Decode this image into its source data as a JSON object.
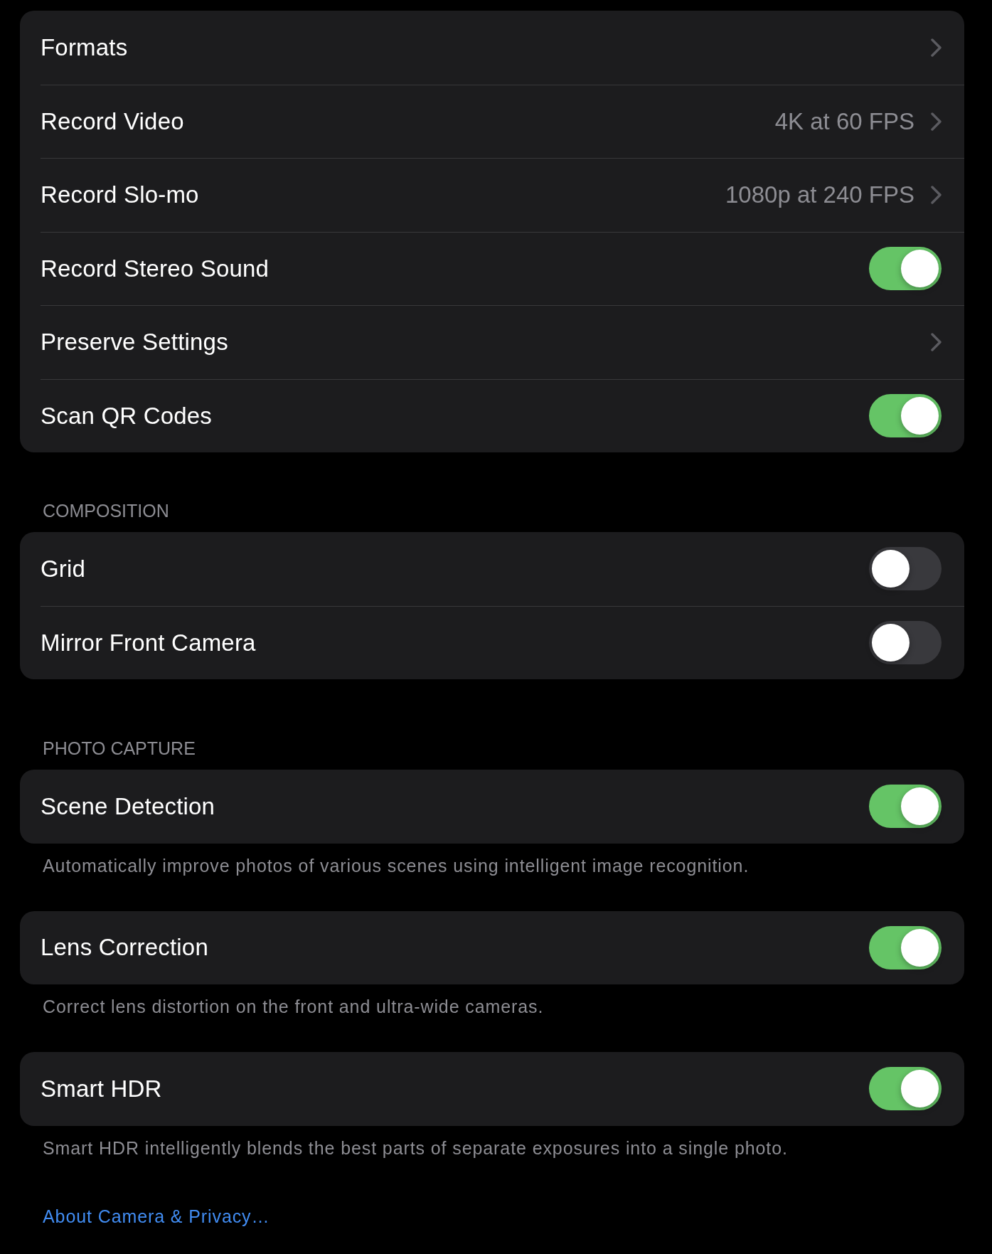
{
  "sections": [
    {
      "rows": [
        {
          "kind": "link",
          "label": "Formats"
        },
        {
          "kind": "link",
          "label": "Record Video",
          "value": "4K at 60 FPS"
        },
        {
          "kind": "link",
          "label": "Record Slo-mo",
          "value": "1080p at 240 FPS"
        },
        {
          "kind": "toggle",
          "label": "Record Stereo Sound",
          "on": true
        },
        {
          "kind": "link",
          "label": "Preserve Settings"
        },
        {
          "kind": "toggle",
          "label": "Scan QR Codes",
          "on": true
        }
      ]
    },
    {
      "header": "COMPOSITION",
      "rows": [
        {
          "kind": "toggle",
          "label": "Grid",
          "on": false
        },
        {
          "kind": "toggle",
          "label": "Mirror Front Camera",
          "on": false
        }
      ]
    },
    {
      "header": "PHOTO CAPTURE",
      "rows": [
        {
          "kind": "toggle",
          "label": "Scene Detection",
          "on": true
        }
      ],
      "footer": "Automatically improve photos of various scenes using intelligent image recognition."
    },
    {
      "rows": [
        {
          "kind": "toggle",
          "label": "Lens Correction",
          "on": true
        }
      ],
      "footer": "Correct lens distortion on the front and ultra-wide cameras."
    },
    {
      "rows": [
        {
          "kind": "toggle",
          "label": "Smart HDR",
          "on": true
        }
      ],
      "footer": "Smart HDR intelligently blends the best parts of separate exposures into a single photo."
    }
  ],
  "link": {
    "label": "About Camera & Privacy…"
  }
}
